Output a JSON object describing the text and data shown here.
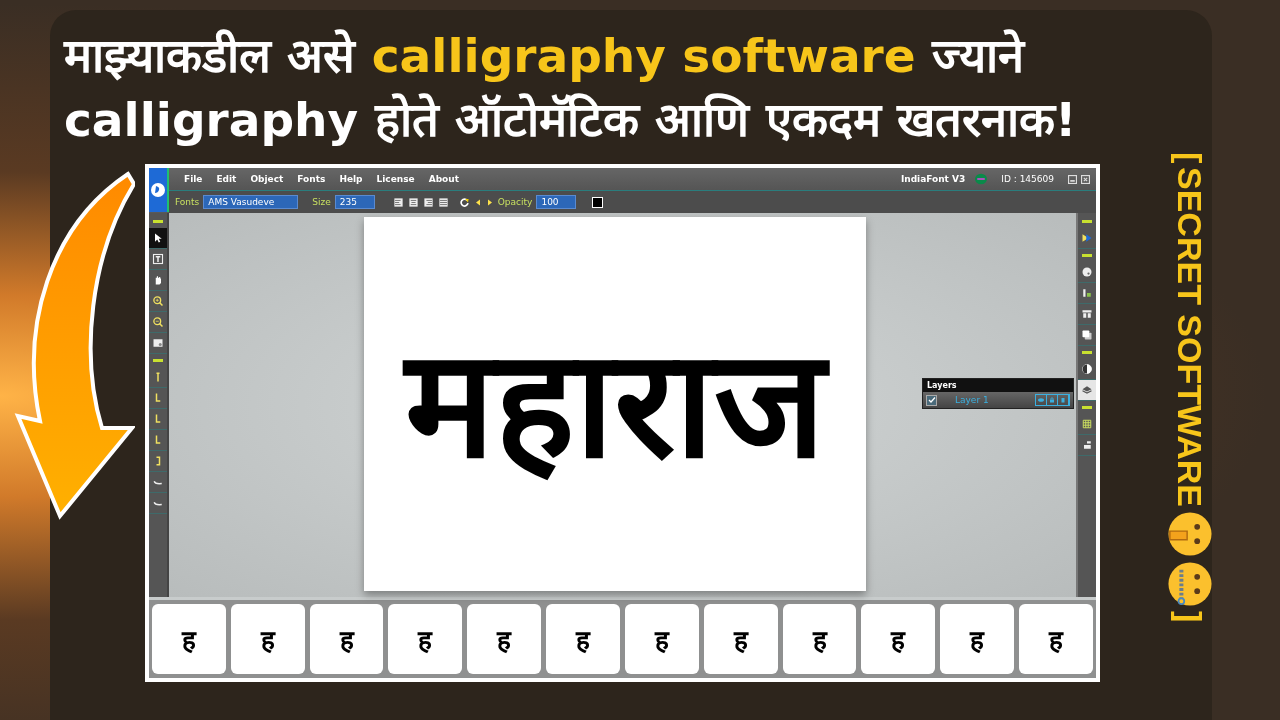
{
  "headline": [
    [
      {
        "text": "माझ्याकडील असे ",
        "highlight": false
      },
      {
        "text": "calligraphy software",
        "highlight": true
      },
      {
        "text": " ज्याने",
        "highlight": false
      }
    ],
    [
      {
        "text": "calligraphy होते ऑटोमॅटिक आणि एकदम खतरनाक!",
        "highlight": false
      }
    ]
  ],
  "side_label": {
    "open": "[",
    "text": "SECRET SOFTWARE",
    "close": "]"
  },
  "app": {
    "menu": [
      "File",
      "Edit",
      "Object",
      "Fonts",
      "Help",
      "License",
      "About"
    ],
    "product": "IndiaFont V3",
    "id_label": "ID : 145609",
    "toolbar": {
      "font_label": "Fonts",
      "font_value": "AMS Vasudeve",
      "size_label": "Size",
      "size_value": "235",
      "opacity_label": "Opacity",
      "opacity_value": "100",
      "color": "#000000"
    },
    "left_tools": [
      {
        "kind": "separator",
        "selected": false
      },
      {
        "kind": "pointer",
        "selected": true
      },
      {
        "kind": "text",
        "selected": false
      },
      {
        "kind": "hand",
        "selected": false
      },
      {
        "kind": "zoom-in",
        "selected": false
      },
      {
        "kind": "zoom-out",
        "selected": false
      },
      {
        "kind": "image",
        "selected": false
      },
      {
        "kind": "separator",
        "selected": false
      },
      {
        "kind": "stroke-a",
        "selected": false
      },
      {
        "kind": "stroke-b",
        "selected": false
      },
      {
        "kind": "stroke-b",
        "selected": false
      },
      {
        "kind": "stroke-b",
        "selected": false
      },
      {
        "kind": "stroke-c",
        "selected": false
      },
      {
        "kind": "stroke-d",
        "selected": false
      },
      {
        "kind": "stroke-d",
        "selected": false
      }
    ],
    "right_tools": [
      {
        "kind": "separator",
        "selected": false
      },
      {
        "kind": "brush",
        "selected": false
      },
      {
        "kind": "separator",
        "selected": false
      },
      {
        "kind": "palette",
        "selected": false
      },
      {
        "kind": "chart",
        "selected": false
      },
      {
        "kind": "columns",
        "selected": false
      },
      {
        "kind": "copy",
        "selected": false
      },
      {
        "kind": "separator",
        "selected": false
      },
      {
        "kind": "contrast",
        "selected": false
      },
      {
        "kind": "layers",
        "selected": true
      },
      {
        "kind": "separator",
        "selected": false
      },
      {
        "kind": "grid",
        "selected": false
      },
      {
        "kind": "align",
        "selected": false
      }
    ],
    "canvas_text": "महाराज",
    "layers_panel": {
      "title": "Layers",
      "layers": [
        {
          "name": "Layer 1",
          "checked": true
        }
      ]
    },
    "glyph_variants": [
      "ह",
      "ह",
      "ह",
      "ह",
      "ह",
      "ह",
      "ह",
      "ह",
      "ह",
      "ह",
      "ह",
      "ह"
    ]
  }
}
